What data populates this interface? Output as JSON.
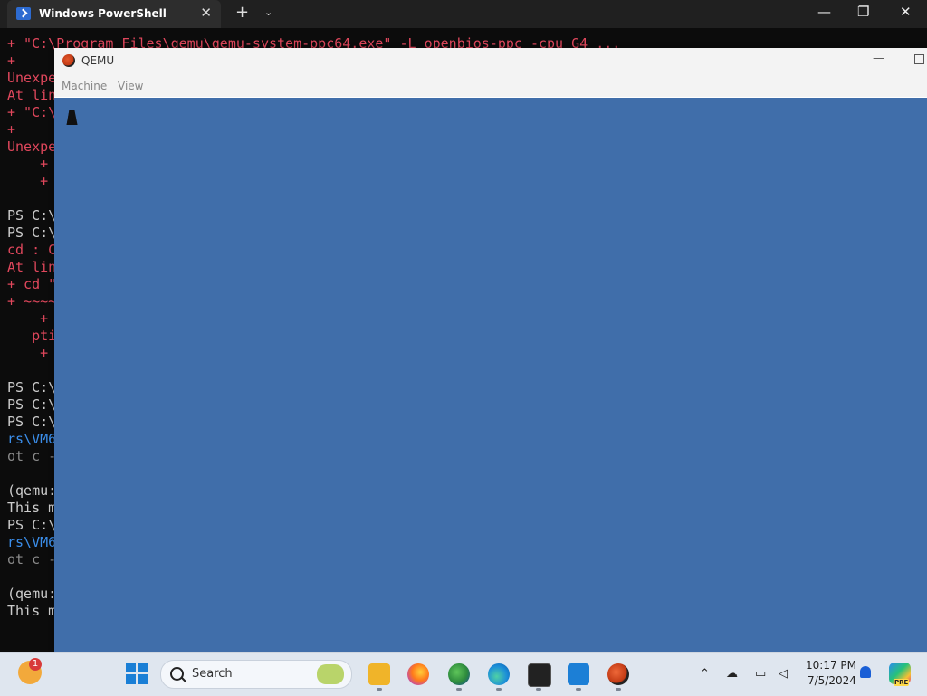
{
  "terminal": {
    "tab_title": "Windows PowerShell",
    "new_tab_glyph": "+",
    "dropdown_glyph": "⌄",
    "close_glyph": "✕",
    "minimize_glyph": "—",
    "restore_glyph": "❐",
    "window_close_glyph": "✕",
    "lines": [
      {
        "text": "+ \"C:\\Program Files\\qemu\\qemu-system-ppc64.exe\" -L openbios-ppc -cpu G4 ...",
        "color": "red"
      },
      {
        "text": "+",
        "color": "red"
      },
      {
        "text": "Unexpe",
        "color": "red"
      },
      {
        "text": "At lin",
        "color": "red"
      },
      {
        "text": "+ \"C:\\",
        "color": "red"
      },
      {
        "text": "+",
        "color": "red"
      },
      {
        "text": "Unexpe",
        "color": "red"
      },
      {
        "text": "    +",
        "color": "red"
      },
      {
        "text": "    +",
        "color": "red"
      },
      {
        "text": "",
        "color": "white"
      },
      {
        "text": "PS C:\\",
        "color": "white"
      },
      {
        "text": "PS C:\\",
        "color": "white"
      },
      {
        "text": "cd : C",
        "color": "red"
      },
      {
        "text": "At lin",
        "color": "red"
      },
      {
        "text": "+ cd \"",
        "color": "red"
      },
      {
        "text": "+ ~~~~",
        "color": "red"
      },
      {
        "text": "    +",
        "color": "red"
      },
      {
        "text": "   pti",
        "color": "red"
      },
      {
        "text": "    +",
        "color": "red"
      },
      {
        "text": "",
        "color": "white"
      },
      {
        "text": "PS C:\\",
        "color": "white"
      },
      {
        "text": "PS C:\\",
        "color": "white"
      },
      {
        "text": "PS C:\\",
        "color": "white"
      },
      {
        "text": "rs\\VM6",
        "color": "blue"
      },
      {
        "text": "ot c -",
        "color": "gray"
      },
      {
        "text": "",
        "color": "white"
      },
      {
        "text": "(qemu:",
        "color": "white"
      },
      {
        "text": "This m",
        "color": "white"
      },
      {
        "text": "PS C:\\",
        "color": "white"
      },
      {
        "text": "rs\\VM6",
        "color": "blue"
      },
      {
        "text": "ot c -",
        "color": "gray"
      },
      {
        "text": "",
        "color": "white"
      },
      {
        "text": "(qemu:",
        "color": "white"
      },
      {
        "text": "This m",
        "color": "white"
      }
    ]
  },
  "qemu": {
    "title": "QEMU",
    "menu": [
      "Machine",
      "View"
    ],
    "minimize_glyph": "—",
    "screen_color": "#406eaa"
  },
  "taskbar": {
    "weather_badge": "1",
    "search_placeholder": "Search",
    "pinned_apps": [
      "file-explorer-icon",
      "firefox-icon",
      "network-globe-icon",
      "edge-icon",
      "terminal-icon",
      "remote-desktop-icon",
      "qemu-icon"
    ],
    "time": "10:17 PM",
    "date": "7/5/2024",
    "copilot_badge": "PRE"
  },
  "colors": {
    "terminal_bg": "#0c0c0c",
    "error_red": "#e0475c",
    "qemu_blue": "#406eaa",
    "taskbar_bg": "#dfe6ef"
  }
}
